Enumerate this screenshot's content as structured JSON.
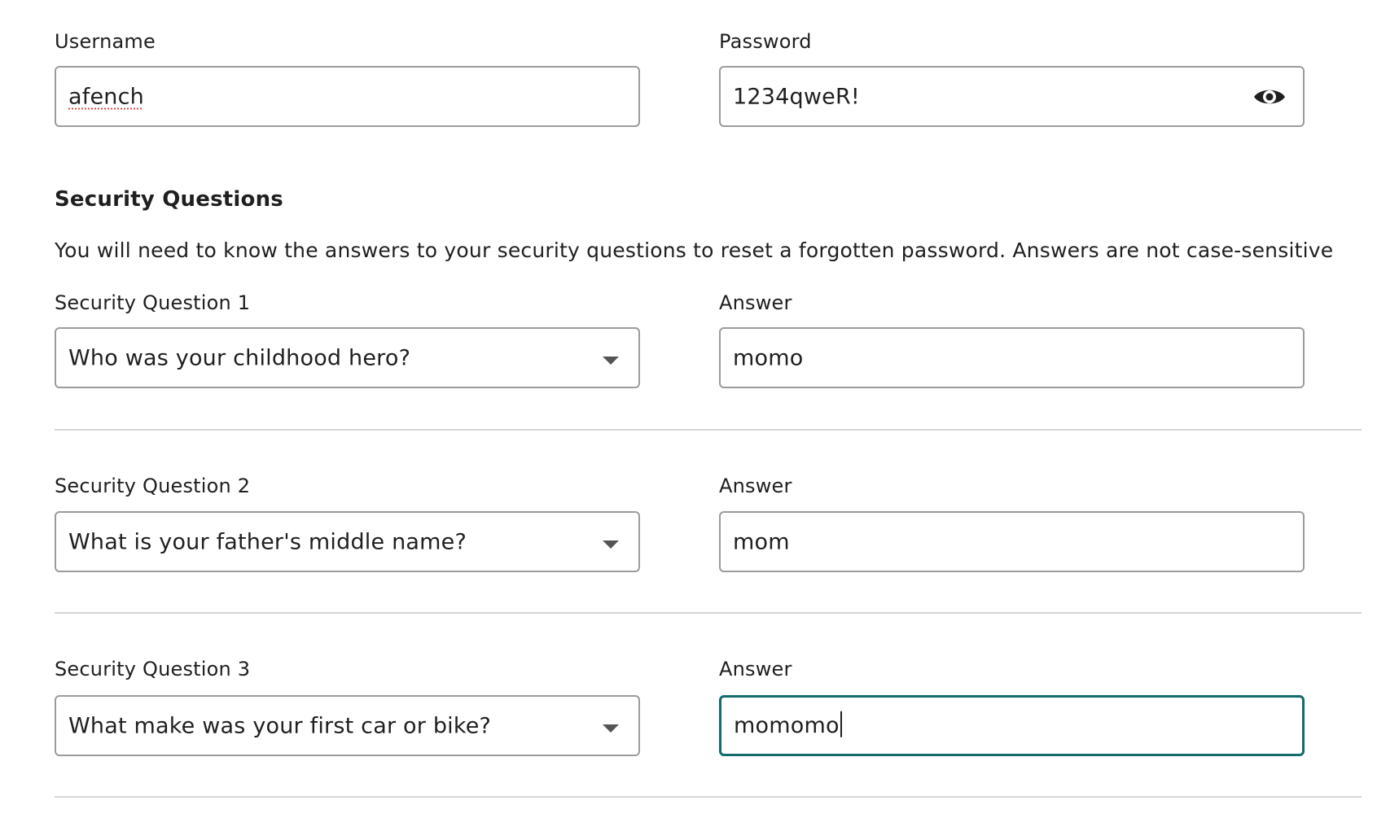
{
  "account": {
    "username_label": "Username",
    "username_value": "afench",
    "password_label": "Password",
    "password_value": "1234qweR!"
  },
  "security": {
    "heading": "Security Questions",
    "description": "You will need to know the answers to your security questions to reset a forgotten password. Answers are not case-sensitive",
    "questions": [
      {
        "label": "Security Question 1",
        "selected": "Who was your childhood hero?",
        "answer_label": "Answer",
        "answer_value": "momo"
      },
      {
        "label": "Security Question 2",
        "selected": "What is your father's middle name?",
        "answer_label": "Answer",
        "answer_value": "mom"
      },
      {
        "label": "Security Question 3",
        "selected": "What make was your first car or bike?",
        "answer_label": "Answer",
        "answer_value": "momomo"
      }
    ]
  },
  "icons": {
    "password_toggle": "eye-icon",
    "dropdown": "chevron-down-icon"
  },
  "colors": {
    "focus_border": "#136b6b",
    "field_border": "#9b9b9b",
    "divider": "#d6d6d6",
    "spellcheck_underline": "#e04848"
  }
}
